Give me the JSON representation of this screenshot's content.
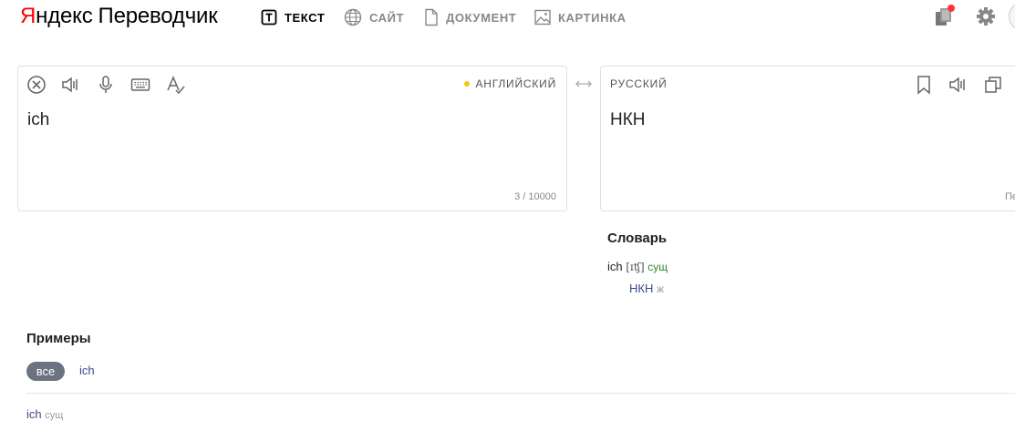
{
  "header": {
    "logo_brand_first": "Я",
    "logo_brand_rest": "ндекс",
    "logo_product": "Переводчик",
    "tabs": [
      {
        "label": "ТЕКСТ",
        "icon": "text-icon",
        "active": true
      },
      {
        "label": "САЙТ",
        "icon": "globe-icon",
        "active": false
      },
      {
        "label": "ДОКУМЕНТ",
        "icon": "document-icon",
        "active": false
      },
      {
        "label": "КАРТИНКА",
        "icon": "image-icon",
        "active": false
      }
    ],
    "right_icons": [
      "collections-icon",
      "gear-icon"
    ],
    "notification_color": "#ff3333"
  },
  "source": {
    "language": "АНГЛИЙСКИЙ",
    "text": "ich",
    "counter": "3 / 10000",
    "toolbar": [
      "clear-icon",
      "speaker-icon",
      "microphone-icon",
      "keyboard-icon",
      "spellcheck-icon"
    ]
  },
  "target": {
    "language": "РУССКИЙ",
    "text": "НКН",
    "cut_text": "Пе",
    "toolbar": [
      "bookmark-icon",
      "speaker-icon",
      "copy-icon"
    ]
  },
  "dictionary": {
    "title": "Словарь",
    "headword": "ich",
    "transcription": "[ɪʧ]",
    "pos": "сущ",
    "translation": "НКН",
    "gender": "ж"
  },
  "examples": {
    "title": "Примеры",
    "filter_all": "все",
    "filter_word": "ich",
    "entry_word": "ich",
    "entry_pos": "сущ"
  }
}
